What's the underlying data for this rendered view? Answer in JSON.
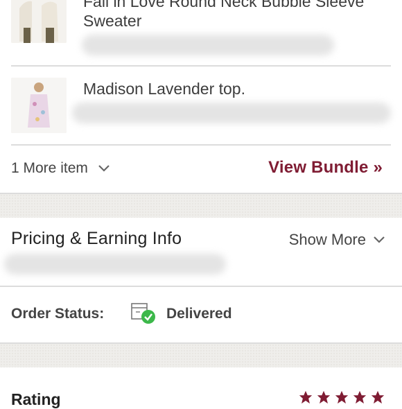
{
  "items": [
    {
      "title_line1": "Fall in Love Round Neck Bubble Sleeve",
      "title_line2": "Sweater",
      "image_icon": "sweater-thumbnail"
    },
    {
      "title_line1": "Madison Lavender top.",
      "image_icon": "top-thumbnail"
    }
  ],
  "bundle": {
    "more_items_label": "1 More item",
    "view_bundle_label": "View Bundle »"
  },
  "pricing": {
    "title": "Pricing & Earning Info",
    "show_more_label": "Show More"
  },
  "order_status": {
    "label": "Order Status:",
    "value": "Delivered",
    "icon": "delivered-box-icon"
  },
  "rating": {
    "label": "Rating",
    "stars": 5,
    "star_color": "#7f1c33"
  },
  "colors": {
    "accent": "#7f1c33",
    "check_green": "#3cb84a",
    "band": "#efeeeb"
  }
}
